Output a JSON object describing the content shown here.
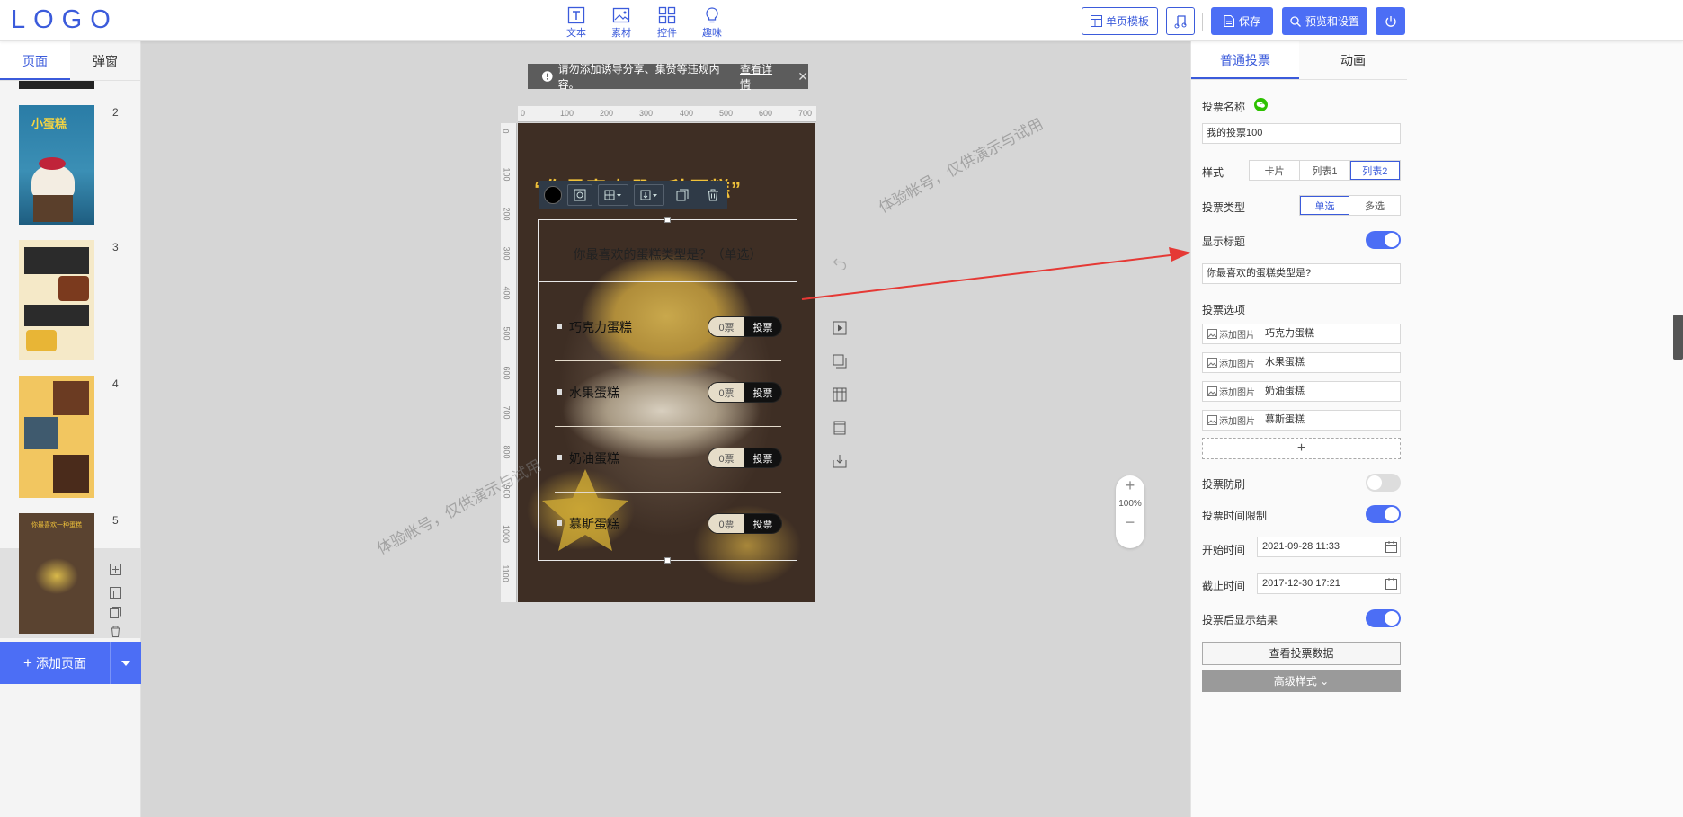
{
  "header": {
    "logo": "LOGO",
    "tools": [
      {
        "label": "文本",
        "icon": "text-icon"
      },
      {
        "label": "素材",
        "icon": "image-icon"
      },
      {
        "label": "控件",
        "icon": "widgets-icon"
      },
      {
        "label": "趣味",
        "icon": "lightbulb-icon"
      }
    ],
    "template_label": "单页模板",
    "save_label": "保存",
    "preview_label": "预览和设置",
    "accent": "#4c6ef5"
  },
  "left": {
    "tabs": [
      "页面",
      "弹窗"
    ],
    "pages": [
      {
        "num": "2",
        "title": "小蛋糕"
      },
      {
        "num": "3",
        "title": ""
      },
      {
        "num": "4",
        "title": ""
      },
      {
        "num": "5",
        "title": "你最喜欢一种蛋糕"
      }
    ],
    "add_page_label": "添加页面"
  },
  "canvas": {
    "notice_text": "请勿添加诱导分享、集赞等违规内容。",
    "notice_link": "查看详情",
    "ruler_h": [
      "0",
      "100",
      "200",
      "300",
      "400",
      "500",
      "600",
      "700"
    ],
    "ruler_v": [
      "0",
      "100",
      "200",
      "300",
      "400",
      "500",
      "600",
      "700",
      "800",
      "900",
      "1000",
      "1100"
    ],
    "page_title": "“你最喜欢哪一种蛋糕”",
    "vote": {
      "question": "你最喜欢的蛋糕类型是？（单选）",
      "options": [
        {
          "name": "巧克力蛋糕",
          "count": "0票",
          "btn": "投票"
        },
        {
          "name": "水果蛋糕",
          "count": "0票",
          "btn": "投票"
        },
        {
          "name": "奶油蛋糕",
          "count": "0票",
          "btn": "投票"
        },
        {
          "name": "慕斯蛋糕",
          "count": "0票",
          "btn": "投票"
        }
      ]
    },
    "zoom": "100%",
    "watermark": "体验帐号，仅供演示与试用"
  },
  "panel": {
    "tabs": [
      "普通投票",
      "动画"
    ],
    "vote_name_label": "投票名称",
    "vote_name": "我的投票100",
    "style_label": "样式",
    "style_options": [
      "卡片",
      "列表1",
      "列表2"
    ],
    "style_selected": "列表2",
    "type_label": "投票类型",
    "type_options": [
      "单选",
      "多选"
    ],
    "type_selected": "单选",
    "show_title_label": "显示标题",
    "title_value": "你最喜欢的蛋糕类型是?",
    "options_label": "投票选项",
    "add_image_label": "添加图片",
    "option_values": [
      "巧克力蛋糕",
      "水果蛋糕",
      "奶油蛋糕",
      "慕斯蛋糕"
    ],
    "anti_brush_label": "投票防刷",
    "time_limit_label": "投票时间限制",
    "start_label": "开始时间",
    "start_value": "2021-09-28 11:33",
    "end_label": "截止时间",
    "end_value": "2017-12-30 17:21",
    "show_result_label": "投票后显示结果",
    "view_data_label": "查看投票数据",
    "advanced_label": "高级样式"
  }
}
